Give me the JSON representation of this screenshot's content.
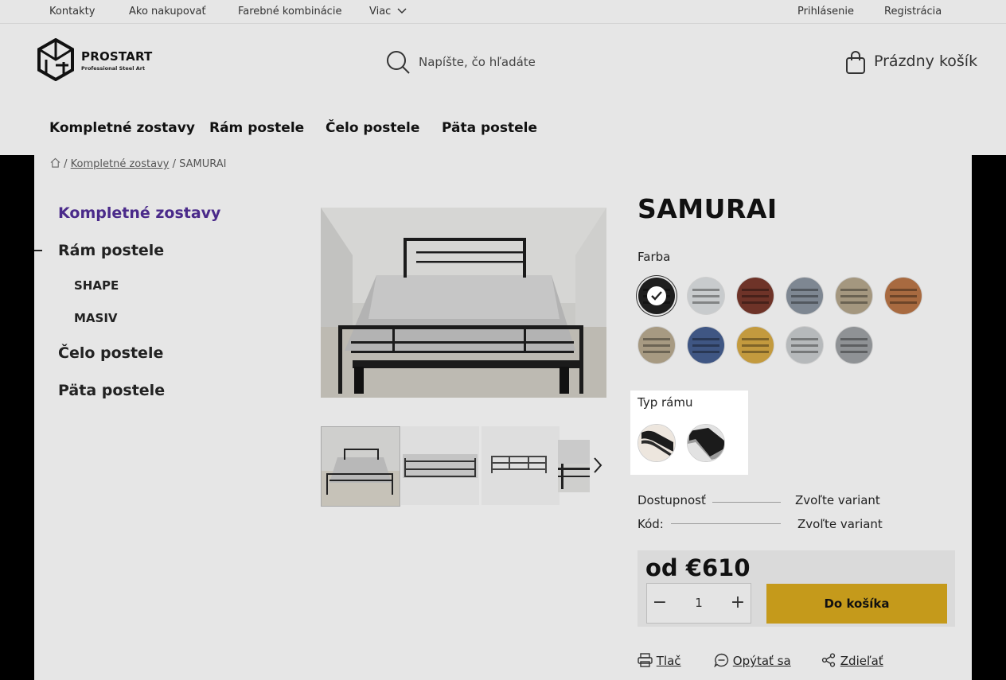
{
  "topbar": {
    "links": [
      "Kontakty",
      "Ako nakupovať",
      "Farebné kombinácie",
      "Viac"
    ],
    "login": "Prihlásenie",
    "register": "Registrácia"
  },
  "header": {
    "logo_name": "PROSTART",
    "logo_tagline": "Professional Steel Art",
    "search_placeholder": "Napíšte, čo hľadáte",
    "cart_label": "Prázdny košík"
  },
  "nav": {
    "items": [
      "Kompletné zostavy",
      "Rám postele",
      "Čelo postele",
      "Päta postele"
    ]
  },
  "breadcrumb": {
    "items": [
      "Kompletné zostavy"
    ],
    "current": "SAMURAI"
  },
  "sidebar": {
    "items": [
      {
        "label": "Kompletné zostavy",
        "active": true
      },
      {
        "label": "Rám postele",
        "expanded": true,
        "children": [
          "SHAPE",
          "MASIV"
        ]
      },
      {
        "label": "Čelo postele"
      },
      {
        "label": "Päta postele"
      }
    ]
  },
  "product": {
    "title": "SAMURAI",
    "color_label": "Farba",
    "colors": [
      "#1e1e1e",
      "#c8cbcd",
      "#6e3328",
      "#7e8792",
      "#a4977f",
      "#a86a40",
      "#a79a82",
      "#3f5683",
      "#c39a3e",
      "#b6b9bb",
      "#8f9295"
    ],
    "selected_color_index": 0,
    "frame_type_label": "Typ rámu",
    "availability_label": "Dostupnosť",
    "availability_value": "Zvoľte variant",
    "code_label": "Kód:",
    "code_value": "Zvoľte variant",
    "price": "od €610",
    "quantity": "1",
    "add_to_cart": "Do košíka",
    "actions": [
      "Tlač",
      "Opýtať sa",
      "Zdieľať"
    ]
  },
  "theme": {
    "accent": "#c59a1b",
    "active_link": "#4a2a8a",
    "overlay_bg": "#e6e6e6"
  }
}
